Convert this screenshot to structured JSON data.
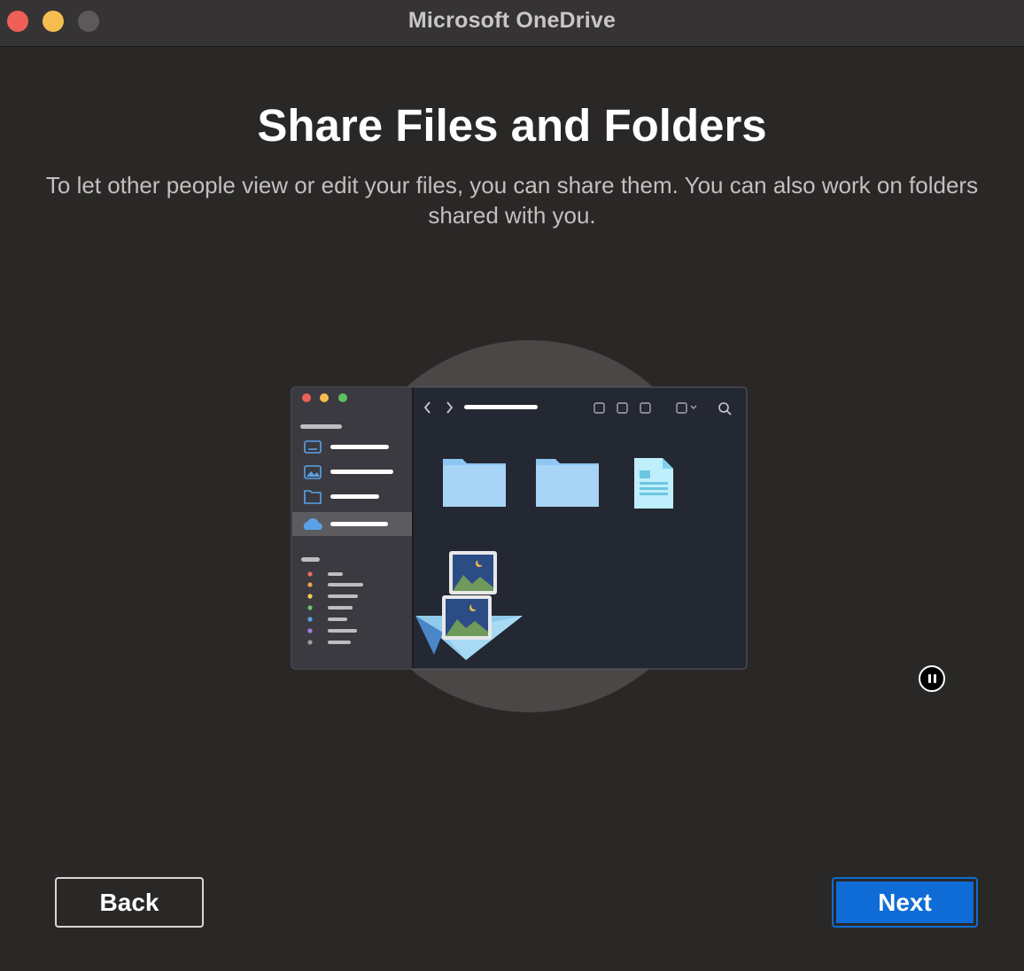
{
  "window": {
    "title": "Microsoft OneDrive"
  },
  "main": {
    "heading": "Share Files and Folders",
    "subtitle": "To let other people view or edit your files, you can share them. You can also work on folders shared with you."
  },
  "illustration": {
    "description_icons": [
      "finder-window-icon",
      "folder-icon",
      "document-icon",
      "paper-plane-icon",
      "photo-icon",
      "onedrive-cloud-icon"
    ]
  },
  "controls": {
    "pause_icon": "pause-icon",
    "back_label": "Back",
    "next_label": "Next"
  },
  "colors": {
    "background": "#2a2827",
    "accent": "#0f6cd6",
    "folder": "#8ec6f2"
  }
}
